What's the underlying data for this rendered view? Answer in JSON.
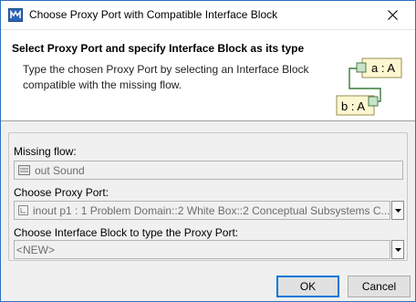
{
  "window": {
    "title": "Choose Proxy Port with Compatible Interface Block"
  },
  "header": {
    "title": "Select Proxy Port and specify Interface Block as its type",
    "description": "Type the chosen Proxy Port by selecting an Interface Block compatible with the missing flow.",
    "diagram": {
      "top_block_label": "a : A",
      "bottom_block_label": "b : A"
    }
  },
  "form": {
    "missing_flow": {
      "label": "Missing flow:",
      "value": "out Sound",
      "icon": "flow-icon"
    },
    "proxy_port": {
      "label": "Choose Proxy Port:",
      "value": "inout p1 : 1 Problem Domain::2 White Box::2 Conceptual Subsystems C...",
      "icon": "port-icon"
    },
    "interface_block": {
      "label": "Choose Interface Block to type the Proxy Port:",
      "value": "<NEW>"
    }
  },
  "buttons": {
    "ok": "OK",
    "cancel": "Cancel"
  },
  "colors": {
    "window_border": "#2d6fbf",
    "block_fill": "#fbf7d0",
    "block_border": "#9a8c55",
    "port_fill": "#c8e3c8",
    "connector": "#3a7a3a",
    "default_button_border": "#0078d7"
  }
}
